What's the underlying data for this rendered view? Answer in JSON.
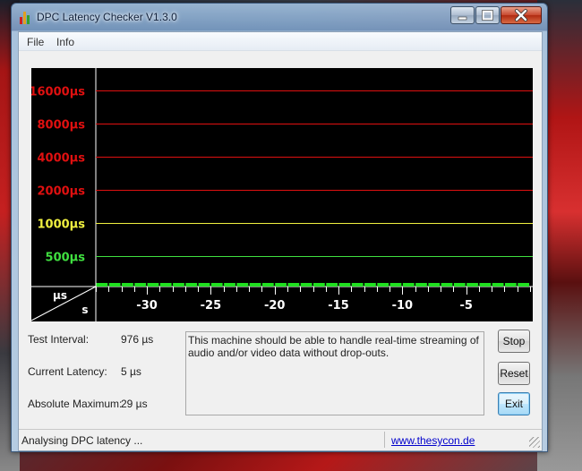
{
  "window": {
    "title": "DPC Latency Checker V1.3.0"
  },
  "menu": {
    "items": [
      "File",
      "Info"
    ]
  },
  "chart_data": {
    "type": "bar",
    "y_scale": "log",
    "y_ticks": [
      "16000µs",
      "8000µs",
      "4000µs",
      "2000µs",
      "1000µs",
      "500µs"
    ],
    "y_tick_values": [
      16000,
      8000,
      4000,
      2000,
      1000,
      500
    ],
    "y_tick_colors": [
      "#e01010",
      "#e01010",
      "#e01010",
      "#e01010",
      "#f0f040",
      "#40e040"
    ],
    "x_ticks": [
      "-30",
      "-25",
      "-20",
      "-15",
      "-10",
      "-5"
    ],
    "x_tick_values": [
      -30,
      -25,
      -20,
      -15,
      -10,
      -5
    ],
    "xlim": [
      -34,
      0
    ],
    "axis_corner_y": "µs",
    "axis_corner_x": "s",
    "bar_color": "#20e020",
    "bar_values_us": [
      5,
      5,
      5,
      5,
      5,
      5,
      5,
      5,
      5,
      5,
      5,
      5,
      5,
      5,
      5,
      5,
      5,
      5,
      5,
      5,
      5,
      5,
      5,
      5,
      5,
      5,
      5,
      5,
      5,
      5,
      5,
      5,
      5,
      5
    ]
  },
  "stats": {
    "test_interval_label": "Test Interval:",
    "test_interval_value": "976 µs",
    "current_latency_label": "Current Latency:",
    "current_latency_value": "5 µs",
    "absolute_max_label": "Absolute Maximum:",
    "absolute_max_value": "29 µs"
  },
  "message": "This machine should be able to handle real-time streaming of audio and/or video data without drop-outs.",
  "buttons": {
    "stop": "Stop",
    "reset": "Reset",
    "exit": "Exit"
  },
  "status": {
    "text": "Analysing DPC latency ...",
    "link": "www.thesycon.de"
  }
}
